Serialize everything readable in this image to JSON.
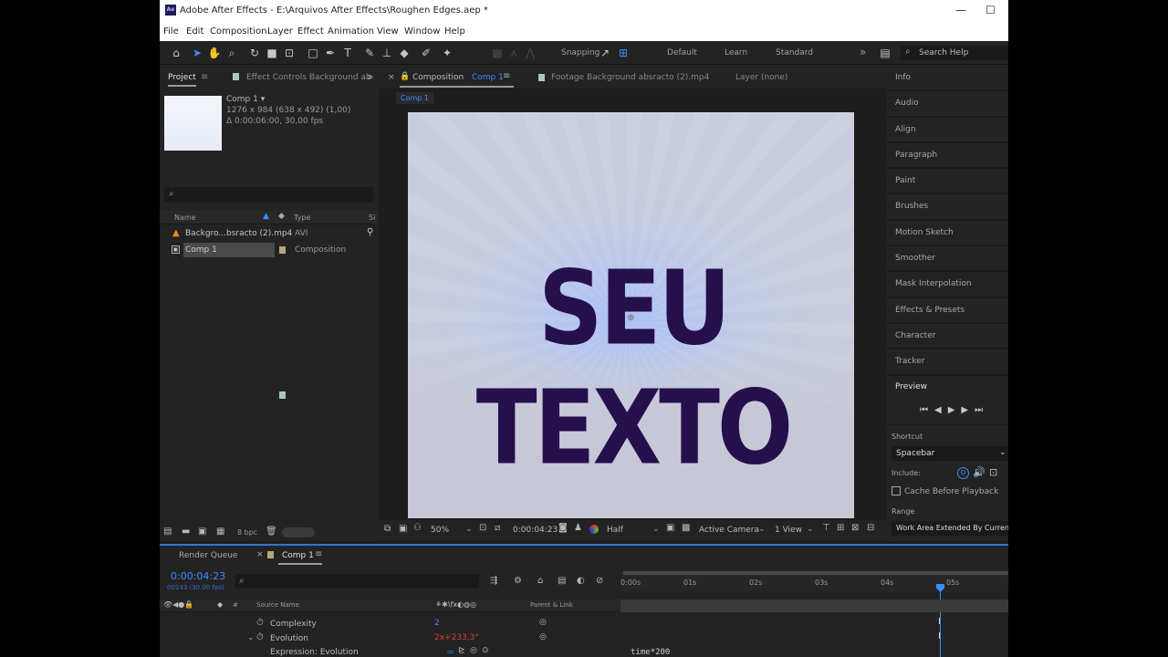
{
  "window": {
    "title": "Adobe After Effects - E:\\Arquivos After Effects\\Roughen Edges.aep *",
    "logo": "Ae",
    "controls": {
      "minimize": "—",
      "maximize": "☐"
    }
  },
  "menu": [
    "File",
    "Edit",
    "Composition",
    "Layer",
    "Effect",
    "Animation",
    "View",
    "Window",
    "Help"
  ],
  "toolbar": {
    "snapping_label": "Snapping",
    "snapping_checked": true,
    "workspaces": [
      "Default",
      "Learn",
      "Standard"
    ],
    "overflow": "»",
    "search_placeholder": "Search Help"
  },
  "project_panel": {
    "tab_project": "Project",
    "tab_effect_controls": "Effect Controls Background ab",
    "overflow": "»",
    "selected_item": {
      "name": "Comp 1 ▾",
      "dimensions": "1276 x 984  (638 x 492) (1,00)",
      "duration": "Δ 0:00:06:00, 30,00 fps"
    },
    "search_placeholder": "",
    "columns": {
      "name": "Name",
      "type": "Type",
      "size": "Si"
    },
    "items": [
      {
        "name": "Backgro...bsracto (2).mp4",
        "type": "AVI",
        "label_color": "#a7c7c9",
        "icon": "vlc-cone-icon"
      },
      {
        "name": "Comp 1",
        "type": "Composition",
        "label_color": "#b9a57c",
        "icon": "composition-icon"
      }
    ],
    "bpc": "8 bpc"
  },
  "viewer": {
    "tab_composition_prefix": "Composition",
    "tab_composition_name": "Comp 1",
    "tab_footage": "Footage  Background absracto (2).mp4",
    "tab_layer": "Layer  (none)",
    "breadcrumb": "Comp 1",
    "canvas_text": "SEU TEXTO",
    "zoom": "50%",
    "timecode": "0:00:04:23",
    "resolution": "Half",
    "camera": "Active Camera",
    "views": "1 View"
  },
  "right_panel": {
    "items": [
      "Info",
      "Audio",
      "Align",
      "Paragraph",
      "Paint",
      "Brushes",
      "Motion Sketch",
      "Smoother",
      "Mask Interpolation",
      "Effects & Presets",
      "Character",
      "Tracker"
    ],
    "preview_title": "Preview",
    "shortcut_label": "Shortcut",
    "shortcut_value": "Spacebar",
    "include_label": "Include:",
    "cache_label": "Cache Before Playback",
    "range_label": "Range",
    "range_value": "Work Area Extended By Current..."
  },
  "timeline": {
    "tab_render_queue": "Render Queue",
    "tab_comp": "Comp 1",
    "close": "×",
    "current_time": "0:00:04:23",
    "frames": "00143 (30.00 fps)",
    "col_source": "Source Name",
    "col_parent": "Parent & Link",
    "ruler": [
      "0:00s",
      "01s",
      "02s",
      "03s",
      "04s",
      "05s"
    ],
    "playhead_fraction": 0.819,
    "rows": [
      {
        "name": "Complexity",
        "value": "2"
      },
      {
        "name": "Evolution",
        "value": "2x+233,3°"
      },
      {
        "name": "Expression: Evolution",
        "value": ""
      }
    ],
    "expression_text": "time*200"
  },
  "colors": {
    "accent": "#3d8cff",
    "text_fill": "#250f4d",
    "value_red": "#d0453b"
  }
}
